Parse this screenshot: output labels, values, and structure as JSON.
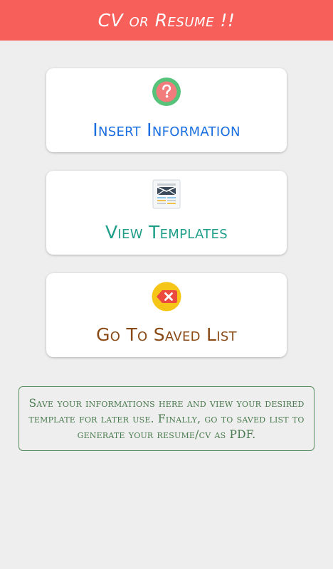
{
  "app_bar": {
    "title": "CV or Resume !!",
    "color": "#f75f5a"
  },
  "menu": [
    {
      "label": "Insert Information",
      "color": "#1a6fe0",
      "icon": "question-mark-icon"
    },
    {
      "label": "View Templates",
      "color": "#1f9e8a",
      "icon": "document-template-icon"
    },
    {
      "label": "Go To Saved List",
      "color": "#8a4a16",
      "icon": "delete-tag-icon"
    }
  ],
  "info": {
    "text": "Save your informations here and view your desired template for later use. Finally, go to saved list to generate your resume/cv as PDF.",
    "color": "#4a7a4f"
  }
}
